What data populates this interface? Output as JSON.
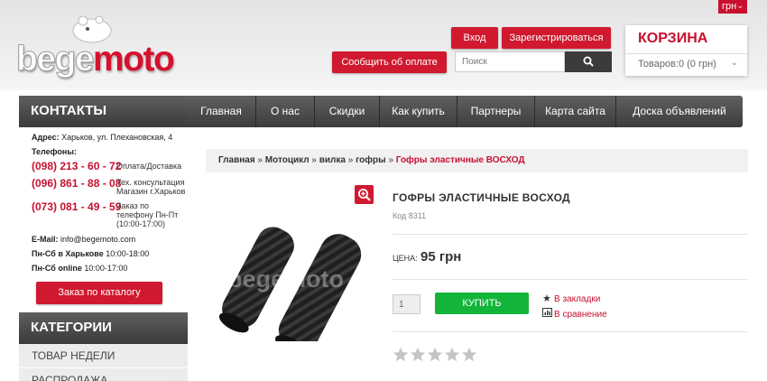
{
  "header": {
    "currency": "грн",
    "logo_part1": "bege",
    "logo_part2": "moto",
    "login_label": "Вход",
    "register_label": "Зарегистрироваться",
    "report_payment_label": "Сообщить об оплате",
    "search_placeholder": "Поиск",
    "cart_title": "КОРЗИНА",
    "cart_count": "Товаров:0 (0 грн)"
  },
  "nav": {
    "items": [
      "Главная",
      "О нас",
      "Скидки",
      "Как купить",
      "Партнеры",
      "Карта сайта",
      "Доска объявлений"
    ]
  },
  "contacts": {
    "heading": "КОНТАКТЫ",
    "address_label": "Адрес:",
    "address": "Харьков, ул. Плехановская, 4",
    "phones_label": "Телефоны:",
    "phones": [
      {
        "number": "(098) 213 - 60 - 72",
        "note1": "Оплата/Доставка",
        "note2": "",
        "note3": ""
      },
      {
        "number": "(096) 861 - 88 - 08",
        "note1": "Тех. консультация",
        "note2": "Магазин г.Харьков",
        "note3": ""
      },
      {
        "number": "(073) 081 - 49 - 59",
        "note1": "Заказ по",
        "note2": "телефону Пн-Пт",
        "note3": "(10:00-17:00)"
      }
    ],
    "email_label": "E-Mail:",
    "email": "info@begemoto.com",
    "hours1_label": "Пн-Сб в Харькове",
    "hours1": "10:00-18:00",
    "hours2_label": "Пн-Сб online",
    "hours2": "10:00-17:00",
    "catalog_order_label": "Заказ по каталогу"
  },
  "categories": {
    "heading": "КАТЕГОРИИ",
    "items": [
      {
        "label": "ТОВАР НЕДЕЛИ"
      },
      {
        "label": "РАСПРОДАЖА"
      }
    ]
  },
  "breadcrumb": {
    "items": [
      "Главная",
      "Мотоцикл",
      "вилка",
      "гофры"
    ],
    "separator": "»",
    "current": "Гофры эластичные ВОСХОД"
  },
  "product": {
    "title": "ГОФРЫ ЭЛАСТИЧНЫЕ ВОСХОД",
    "code": "Код 8311",
    "price_label": "ЦЕНА:",
    "price": "95 грн",
    "quantity": "1",
    "buy_label": "КУПИТЬ",
    "bookmark_label": "В закладки",
    "compare_label": "В сравнение",
    "rating": 0,
    "rating_max": 5,
    "image_watermark": "begemoto"
  },
  "colors": {
    "accent_red": "#d0192f",
    "buy_green": "#12b53a",
    "dark_bar": "#3c3c3c"
  }
}
